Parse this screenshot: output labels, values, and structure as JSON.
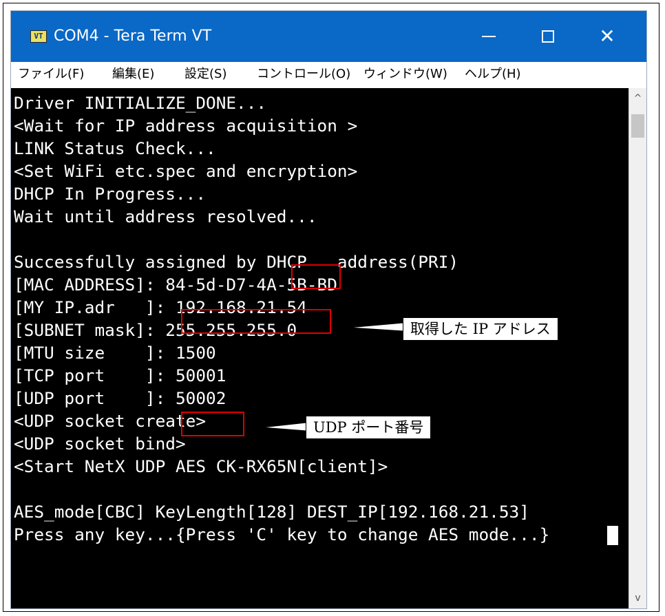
{
  "window": {
    "title": "COM4 - Tera Term VT",
    "icon_text": "VT",
    "controls": {
      "minimize_icon": "minimize-icon",
      "maximize_icon": "maximize-icon",
      "close_icon": "close-icon",
      "close_glyph": "✕"
    }
  },
  "menu": [
    {
      "label": "ファイル(F)"
    },
    {
      "label": "編集(E)"
    },
    {
      "label": "設定(S)"
    },
    {
      "label": "コントロール(O)"
    },
    {
      "label": "ウィンドウ(W)"
    },
    {
      "label": "ヘルプ(H)"
    }
  ],
  "terminal": {
    "lines": [
      "Driver INITIALIZE_DONE...",
      "<Wait for IP address acquisition >",
      "LINK Status Check...",
      "<Set WiFi etc.spec and encryption>",
      "DHCP In Progress...",
      "Wait until address resolved...",
      "",
      "Successfully assigned by DHCP   address(PRI)",
      "[MAC ADDRESS]: 84-5d-D7-4A-5B-BD",
      "[MY IP.adr   ]: 192.168.21.54",
      "[SUBNET mask]: 255.255.255.0",
      "[MTU size    ]: 1500",
      "[TCP port    ]: 50001",
      "[UDP port    ]: 50002",
      "<UDP socket create>",
      "<UDP socket bind>",
      "<Start NetX UDP AES CK-RX65N[client]>",
      "",
      "AES_mode[CBC] KeyLength[128] DEST_IP[192.168.21.53]",
      "Press any key...{Press 'C' key to change AES mode...}"
    ],
    "background": "#000000",
    "foreground": "#ffffff"
  },
  "annotations": {
    "ip_callout": "取得した IP アドレス",
    "udp_callout": "UDP ポート番号",
    "highlight_color": "#e00000"
  },
  "scrollbar": {
    "up_icon": "scroll-up-arrow-icon",
    "down_icon": "scroll-down-arrow-icon",
    "up_glyph": "^",
    "down_glyph": "v"
  },
  "colors": {
    "titlebar": "#0a68c6"
  }
}
